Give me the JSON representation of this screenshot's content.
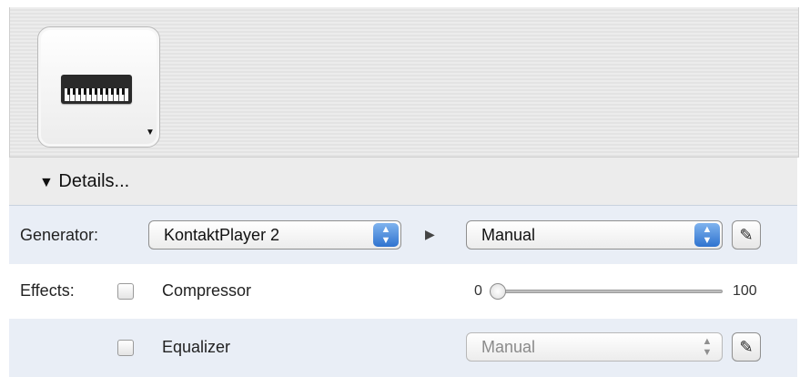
{
  "details": {
    "title": "Details..."
  },
  "generator": {
    "label": "Generator:",
    "selected": "KontaktPlayer 2",
    "mode": "Manual"
  },
  "effects": {
    "label": "Effects:",
    "compressor": {
      "name": "Compressor",
      "slider_min": "0",
      "slider_max": "100",
      "slider_value_fraction": 0
    },
    "equalizer": {
      "name": "Equalizer",
      "mode": "Manual"
    }
  },
  "icons": {
    "instrument": "piano-keyboard-icon",
    "disclosure": "triangle-down-icon",
    "arrow": "play-arrow-icon",
    "edit": "pencil-icon",
    "stepper": "up-down-arrows-icon"
  },
  "colors": {
    "accent": "#2f73cf",
    "row_highlight": "#e9eef6"
  }
}
